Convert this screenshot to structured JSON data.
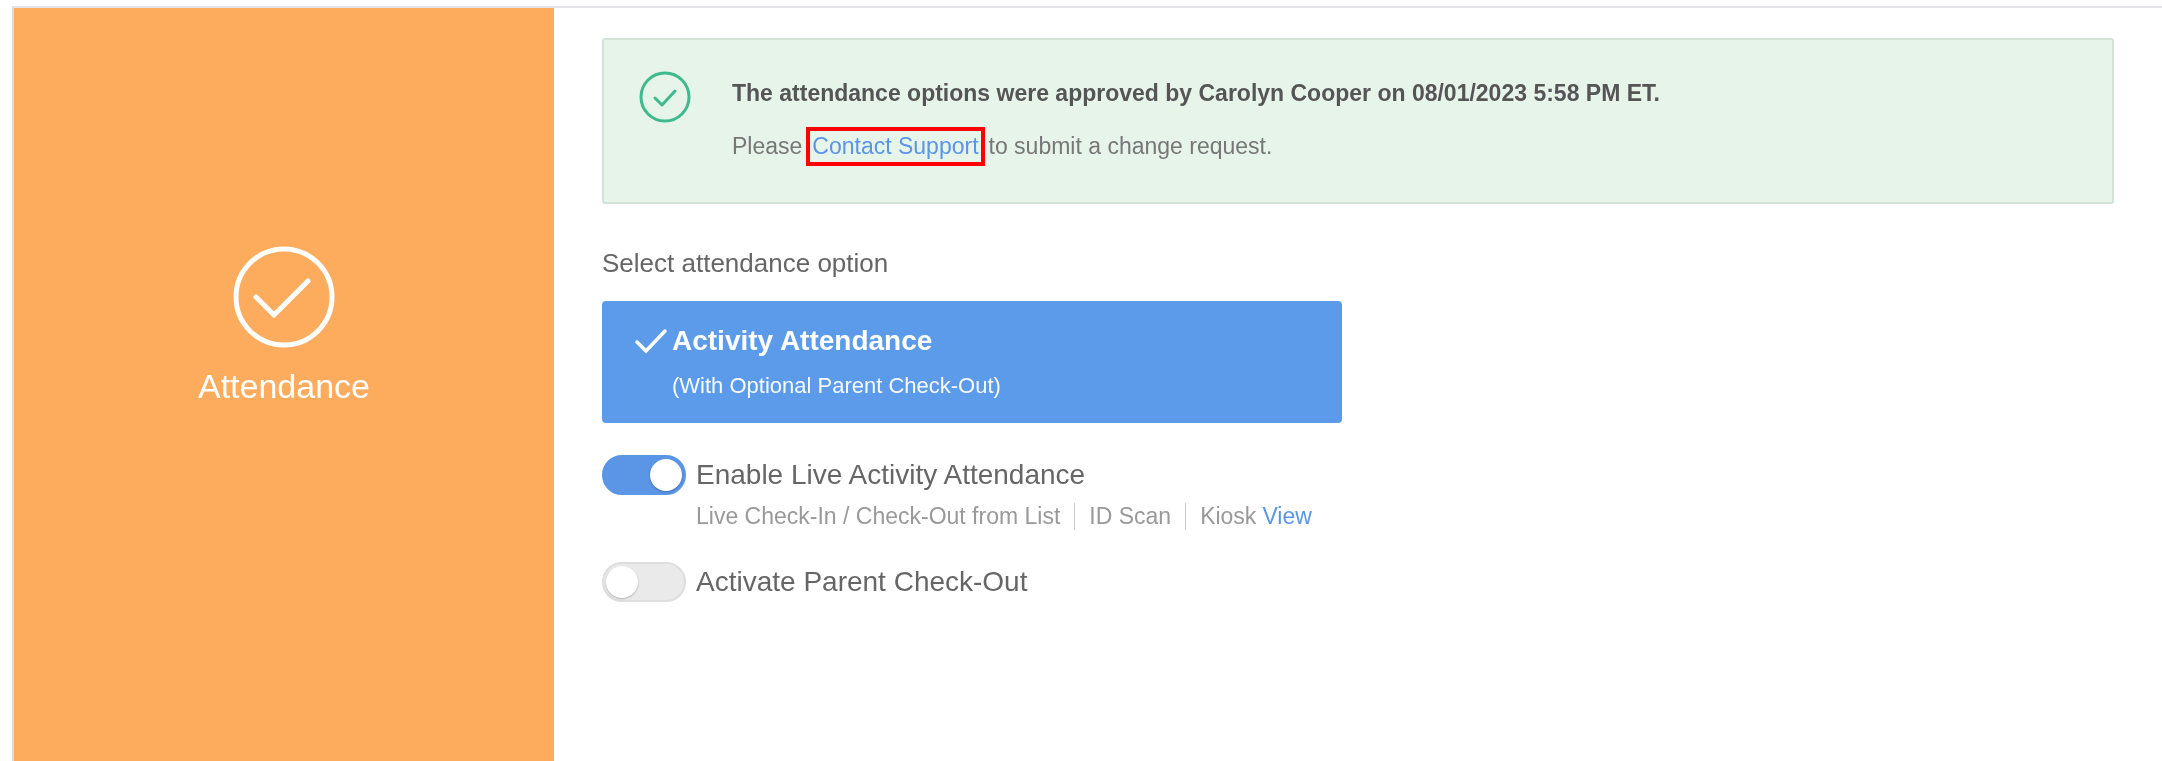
{
  "side_panel": {
    "title": "Attendance"
  },
  "notice": {
    "message": "The attendance options were approved by Carolyn Cooper on 08/01/2023 5:58 PM ET.",
    "prefix": "Please",
    "link": {
      "label": "Contact Support",
      "highlighted": true
    },
    "suffix": "to submit a change request."
  },
  "option_heading": "Select attendance option",
  "options": [
    {
      "title": "Activity Attendance",
      "subtitle": "(With Optional Parent Check-Out)",
      "selected": true
    }
  ],
  "toggles": [
    {
      "label": "Enable Live Activity Attendance",
      "on": true,
      "details": [
        [
          {
            "kind": "text",
            "text": "Live Check-In / Check-Out from List"
          }
        ],
        [
          {
            "kind": "text",
            "text": "ID Scan"
          }
        ],
        [
          {
            "kind": "text",
            "text": "Kiosk"
          },
          {
            "kind": "link",
            "text": "View"
          }
        ]
      ]
    },
    {
      "label": "Activate Parent Check-Out",
      "on": false
    }
  ]
}
